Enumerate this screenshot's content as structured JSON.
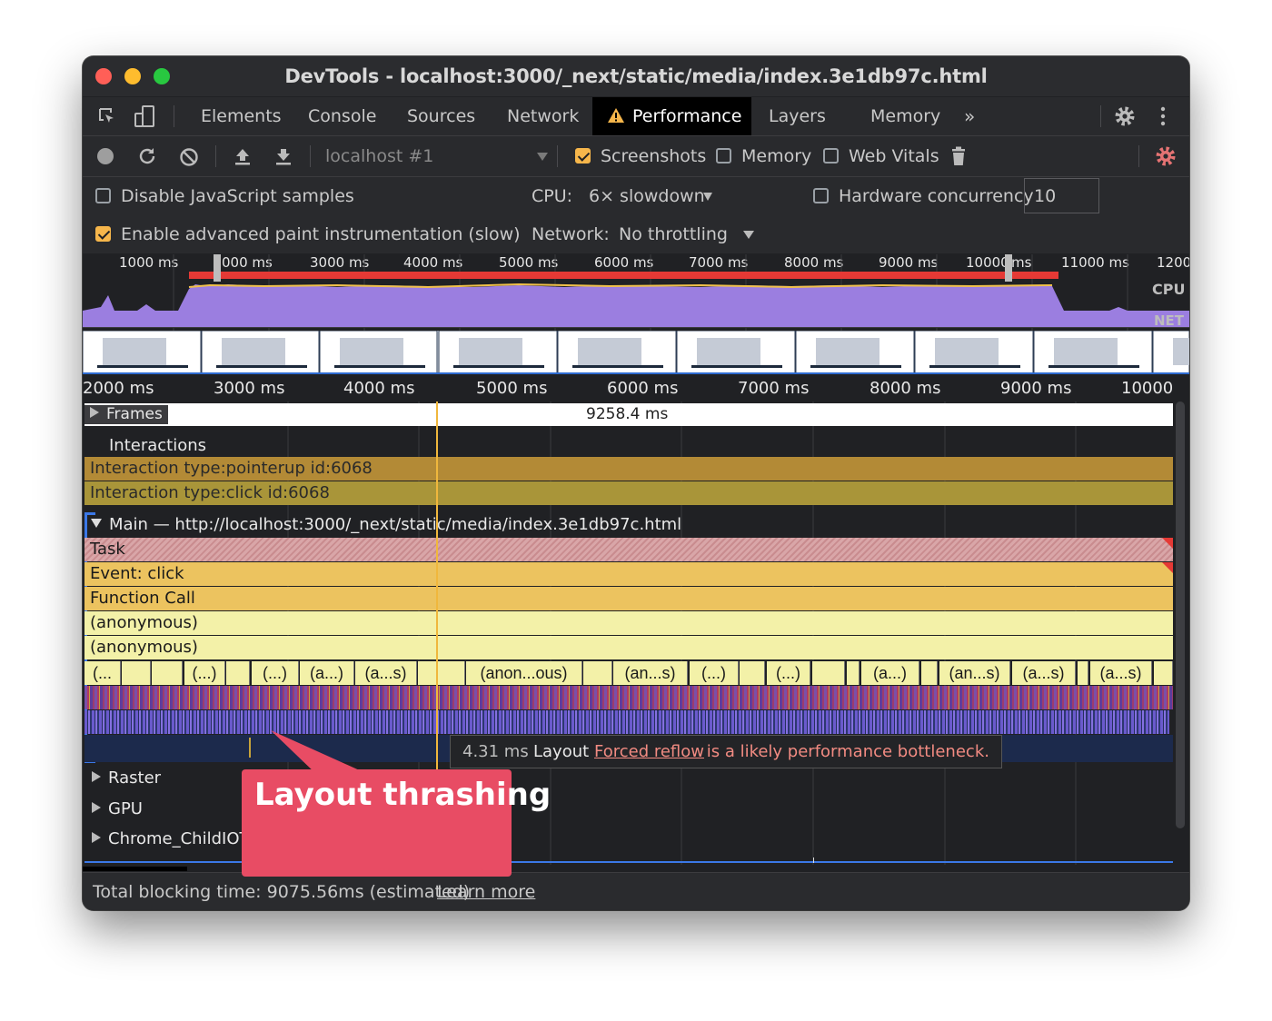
{
  "window": {
    "title": "DevTools - localhost:3000/_next/static/media/index.3e1db97c.html"
  },
  "tabs": [
    "Elements",
    "Console",
    "Sources",
    "Network",
    "Performance",
    "Layers",
    "Memory"
  ],
  "active_tab": "Performance",
  "tab_overflow": "»",
  "toolbar": {
    "profile_select": "localhost #1",
    "screenshots_label": "Screenshots",
    "screenshots_checked": true,
    "memory_label": "Memory",
    "memory_checked": false,
    "web_vitals_label": "Web Vitals",
    "web_vitals_checked": false
  },
  "settings": {
    "disable_js_samples_label": "Disable JavaScript samples",
    "disable_js_samples_checked": false,
    "advanced_paint_label": "Enable advanced paint instrumentation (slow)",
    "advanced_paint_checked": true,
    "cpu_label": "CPU:",
    "cpu_value": "6× slowdown",
    "network_label": "Network:",
    "network_value": "No throttling",
    "hw_concurrency_label": "Hardware concurrency",
    "hw_concurrency_checked": false,
    "hw_concurrency_value": "10"
  },
  "overview": {
    "ticks": [
      "1000 ms",
      "000 ms",
      "3000 ms",
      "4000 ms",
      "5000 ms",
      "6000 ms",
      "7000 ms",
      "8000 ms",
      "9000 ms",
      "10000",
      "ms",
      "11000 ms",
      "1200"
    ],
    "cpu_label": "CPU",
    "net_label": "NET"
  },
  "ruler": {
    "ticks": [
      "2000 ms",
      "3000 ms",
      "4000 ms",
      "5000 ms",
      "6000 ms",
      "7000 ms",
      "8000 ms",
      "9000 ms",
      "10000"
    ]
  },
  "tracks": {
    "frames_label": "Frames",
    "frames_duration": "9258.4 ms",
    "interactions_label": "Interactions",
    "interaction_pointerup": "Interaction type:pointerup id:6068",
    "interaction_click": "Interaction type:click id:6068",
    "main_label": "Main — http://localhost:3000/_next/static/media/index.3e1db97c.html",
    "task": "Task",
    "event_click": "Event: click",
    "function_call": "Function Call",
    "anonymous_1": "(anonymous)",
    "anonymous_2": "(anonymous)",
    "call_segments": [
      "(...",
      "",
      "",
      "(...)",
      "",
      "(...)",
      "(a...)",
      "(a...s)",
      "",
      "(anon...ous)",
      "",
      "(an...s)",
      "(...)",
      "",
      "(...)",
      "",
      "",
      "(a...)",
      "",
      "(an...s)",
      "(a...s)",
      "",
      "(a...s)",
      ""
    ],
    "raster_label": "Raster",
    "gpu_label": "GPU",
    "child_io_label": "Chrome_ChildIOT"
  },
  "tooltip": {
    "duration": "4.31 ms",
    "event": "Layout",
    "link": "Forced reflow",
    "message": " is a likely performance bottleneck."
  },
  "callout": {
    "text": "Layout thrashing"
  },
  "status": {
    "total_blocking": "Total blocking time: 9075.56ms (estimated)",
    "learn_more": "Learn more"
  },
  "colors": {
    "task": "#d9a6a8",
    "event_click": "#ecc35f",
    "function_call": "#ecc35f",
    "anonymous": "#f3f1a8",
    "interaction_pointerup": "#b38a36",
    "interaction_click": "#a99539",
    "callout": "#e84c64",
    "cpu_overview": "#9b7ee0",
    "long_task_bar": "#e53935",
    "tab_warning": "#f6b64b"
  }
}
